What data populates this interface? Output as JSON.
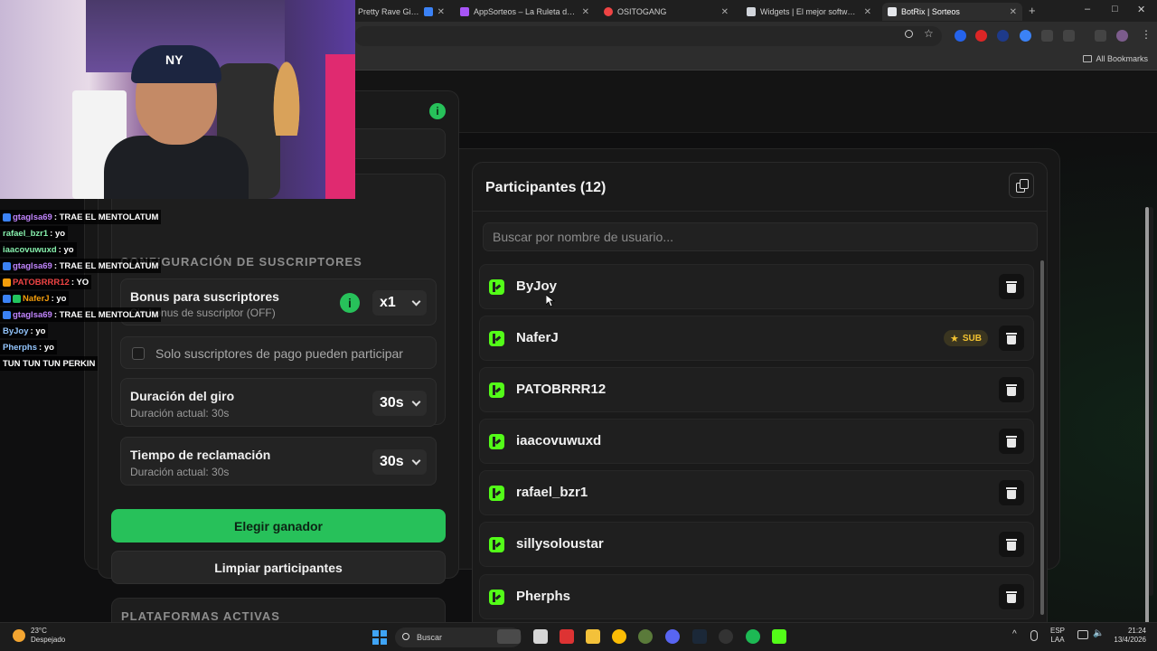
{
  "browser": {
    "tabs": [
      {
        "label": "Pretty Rave Girl (Ori",
        "icon_color": "#3b82f6",
        "close": "✕"
      },
      {
        "label": "AppSorteos – La Ruleta de la S",
        "icon_color": "#a855f7",
        "close": "✕"
      },
      {
        "label": "OSITOGANG",
        "icon_color": "#ef4444",
        "close": "✕"
      },
      {
        "label": "Widgets | El mejor software pa",
        "icon_color": "#d1d5db",
        "close": "✕"
      },
      {
        "label": "BotRix | Sorteos",
        "icon_color": "#e5e7eb",
        "close": "✕"
      }
    ],
    "new_tab": "+",
    "window_controls": {
      "minimize": "–",
      "maximize": "□",
      "close": "✕"
    },
    "all_bookmarks": "All Bookmarks"
  },
  "left_panel": {
    "info_icon": "i",
    "subscriber_config_title": "CONFIGURACIÓN DE SUSCRIPTORES",
    "bonus": {
      "title": "Bonus para suscriptores",
      "subtitle": "Sin bonus de suscriptor (OFF)",
      "info_icon": "i",
      "value": "x1"
    },
    "paid_only": {
      "label": "Solo suscriptores de pago pueden participar"
    },
    "spin_duration": {
      "title": "Duración del giro",
      "subtitle": "Duración actual: 30s",
      "value": "30s"
    },
    "claim_time": {
      "title": "Tiempo de reclamación",
      "subtitle": "Duración actual: 30s",
      "value": "30s"
    },
    "choose_winner": "Elegir ganador",
    "clear_participants": "Limpiar participantes",
    "platforms_title": "PLATAFORMAS ACTIVAS"
  },
  "participants": {
    "title": "Participantes (12)",
    "search_placeholder": "Buscar por nombre de usuario...",
    "list": [
      {
        "name": "ByJoy",
        "sub": false
      },
      {
        "name": "NaferJ",
        "sub": true
      },
      {
        "name": "PATOBRRR12",
        "sub": false
      },
      {
        "name": "iaacovuwuxd",
        "sub": false
      },
      {
        "name": "rafael_bzr1",
        "sub": false
      },
      {
        "name": "sillysoloustar",
        "sub": false
      },
      {
        "name": "Pherphs",
        "sub": false
      }
    ],
    "sub_badge": "SUB",
    "sub_star": "★",
    "platform_icon": "kick-icon"
  },
  "webcam": {
    "cap_logo": "NY"
  },
  "chat": [
    {
      "user": "gtaglsa69",
      "color": "#c084fc",
      "message": ": TRAE EL MENTOLATUM"
    },
    {
      "user": "rafael_bzr1",
      "color": "#86efac",
      "message": ": yo"
    },
    {
      "user": "iaacovuwuxd",
      "color": "#86efac",
      "message": ": yo"
    },
    {
      "user": "gtaglsa69",
      "color": "#c084fc",
      "message": ": TRAE EL MENTOLATUM"
    },
    {
      "user": "PATOBRRR12",
      "color": "#ef4444",
      "message": ": YO"
    },
    {
      "user": "NaferJ",
      "color": "#f59e0b",
      "message": ": yo"
    },
    {
      "user": "gtaglsa69",
      "color": "#c084fc",
      "message": ": TRAE EL MENTOLATUM"
    },
    {
      "user": "ByJoy",
      "color": "#93c5fd",
      "message": ": yo"
    },
    {
      "user": "Pherphs",
      "color": "#93c5fd",
      "message": ": yo"
    },
    {
      "user": "",
      "color": "#ffffff",
      "message": "TUN TUN TUN PERKIN"
    }
  ],
  "taskbar": {
    "temperature": "23°C",
    "weather": "Despejado",
    "search": "Buscar",
    "lang_top": "ESP",
    "lang_bottom": "LAA",
    "time": "21:24",
    "date": "13/4/2026"
  },
  "colors": {
    "accent": "#27c15a",
    "kick": "#53fc18",
    "sub": "#f2c231"
  }
}
